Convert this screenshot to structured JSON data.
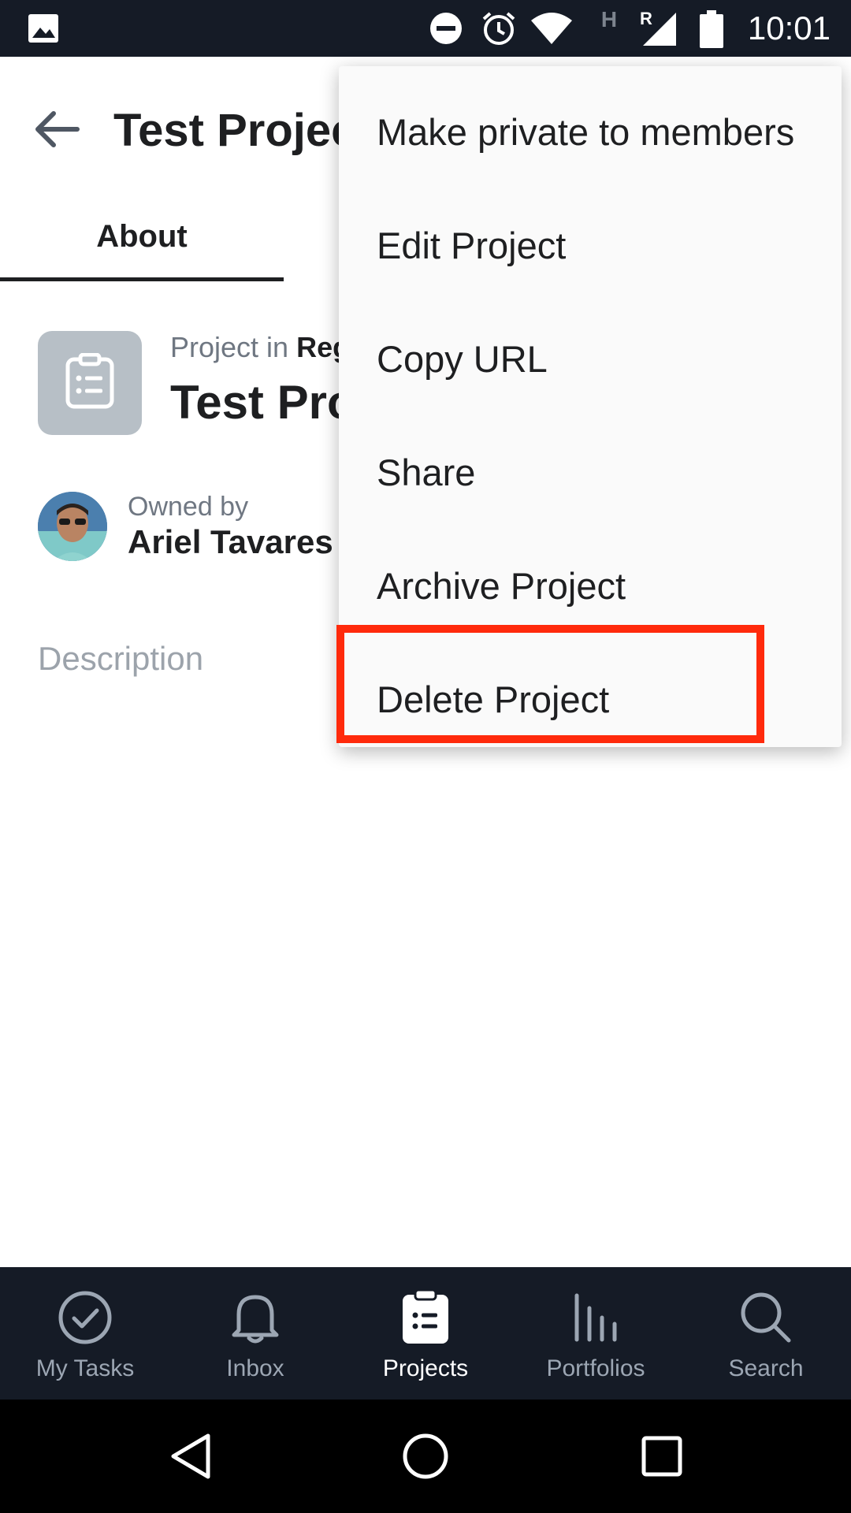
{
  "status_bar": {
    "time": "10:01",
    "network_type": "H",
    "roaming": "R",
    "icons": [
      "image-notification-icon",
      "do-not-disturb-icon",
      "alarm-icon",
      "wifi-icon",
      "signal-icon",
      "battery-icon"
    ]
  },
  "header": {
    "back_icon": "arrow-left-icon",
    "title": "Test Projec"
  },
  "tabs": [
    {
      "label": "About",
      "active": true
    }
  ],
  "project": {
    "subtitle_prefix": "Project in",
    "team_name": "Reg",
    "name": "Test Pro",
    "icon": "clipboard-list-icon"
  },
  "owner": {
    "label": "Owned by",
    "name": "Ariel Tavares C"
  },
  "description": {
    "label": "Description"
  },
  "menu": {
    "items": [
      {
        "label": "Make private to members"
      },
      {
        "label": "Edit Project"
      },
      {
        "label": "Copy URL"
      },
      {
        "label": "Share"
      },
      {
        "label": "Archive Project"
      },
      {
        "label": "Delete Project"
      }
    ],
    "highlight_color": "#ff2a0c"
  },
  "bottom_nav": {
    "items": [
      {
        "label": "My Tasks",
        "icon": "check-circle-icon",
        "active": false
      },
      {
        "label": "Inbox",
        "icon": "bell-icon",
        "active": false
      },
      {
        "label": "Projects",
        "icon": "clipboard-icon",
        "active": true
      },
      {
        "label": "Portfolios",
        "icon": "bar-chart-icon",
        "active": false
      },
      {
        "label": "Search",
        "icon": "search-icon",
        "active": false
      }
    ]
  },
  "system_nav": {
    "buttons": [
      "back-triangle-icon",
      "home-circle-icon",
      "recents-square-icon"
    ]
  },
  "colors": {
    "dark_bar": "#151b26",
    "text_primary": "#1e1f21",
    "text_secondary": "#6f7782",
    "project_icon_bg": "#b7bfc6"
  }
}
